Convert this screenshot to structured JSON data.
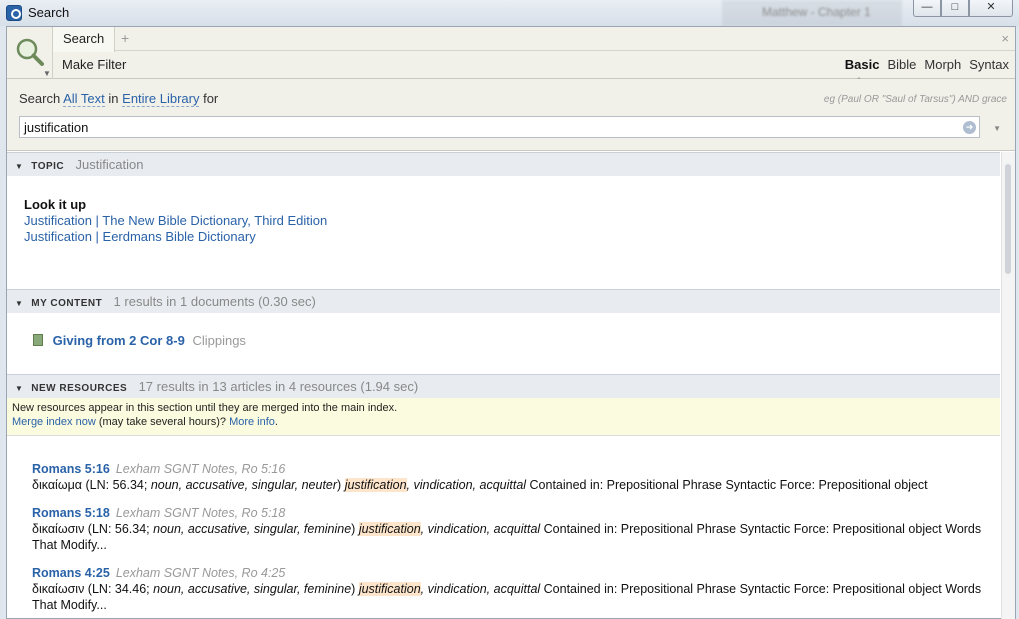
{
  "window": {
    "title": "Search",
    "behind_tab": "Matthew - Chapter 1"
  },
  "toolbar": {
    "tab_label": "Search",
    "add_tab": "+",
    "close_tab": "×",
    "make_filter": "Make Filter",
    "modes": [
      "Basic",
      "Bible",
      "Morph",
      "Syntax"
    ],
    "active_mode": "Basic"
  },
  "search": {
    "prefix": "Search",
    "scope_text": "All Text",
    "in_word": "in",
    "scope_library": "Entire Library",
    "for_word": "for",
    "example": "eg (Paul OR \"Saul of Tarsus\") AND grace",
    "query": "justification"
  },
  "topic": {
    "label": "TOPIC",
    "meta": "Justification",
    "lookup_title": "Look it up",
    "links": [
      "Justification | The New Bible Dictionary, Third Edition",
      "Justification | Eerdmans Bible Dictionary"
    ]
  },
  "my_content": {
    "label": "MY CONTENT",
    "meta": "1 results in 1 documents (0.30 sec)",
    "item_title": "Giving from 2 Cor 8-9",
    "item_kind": "Clippings"
  },
  "new_resources": {
    "label": "NEW RESOURCES",
    "meta": "17 results in 13 articles in 4 resources (1.94 sec)",
    "notice_line1": "New resources appear in this section until they are merged into the main index.",
    "merge_link": "Merge index now",
    "notice_mid": " (may take several hours)? ",
    "more_info": "More info",
    "notice_end": "."
  },
  "results": [
    {
      "ref": "Romans 5:16",
      "source": "Lexham SGNT Notes, Ro 5:16",
      "pre": "δικαίωμα (LN: 56.34; ",
      "ital": "noun, accusative, singular, neuter",
      "mid": ") ",
      "hl": "justification",
      "post_ital": ", vindication, acquittal",
      "tail": " Contained in: Prepositional Phrase Syntactic Force: Prepositional object"
    },
    {
      "ref": "Romans 5:18",
      "source": "Lexham SGNT Notes, Ro 5:18",
      "pre": "δικαίωσιν (LN: 56.34; ",
      "ital": "noun, accusative, singular, feminine",
      "mid": ") ",
      "hl": "justification",
      "post_ital": ", vindication, acquittal",
      "tail": " Contained in: Prepositional Phrase Syntactic Force: Prepositional object Words That Modify..."
    },
    {
      "ref": "Romans 4:25",
      "source": "Lexham SGNT Notes, Ro 4:25",
      "pre": "δικαίωσιν (LN: 34.46; ",
      "ital": "noun, accusative, singular, feminine",
      "mid": ") ",
      "hl": "justification",
      "post_ital": ", vindication, acquittal",
      "tail": " Contained in: Prepositional Phrase Syntactic Force: Prepositional object Words That Modify..."
    }
  ]
}
